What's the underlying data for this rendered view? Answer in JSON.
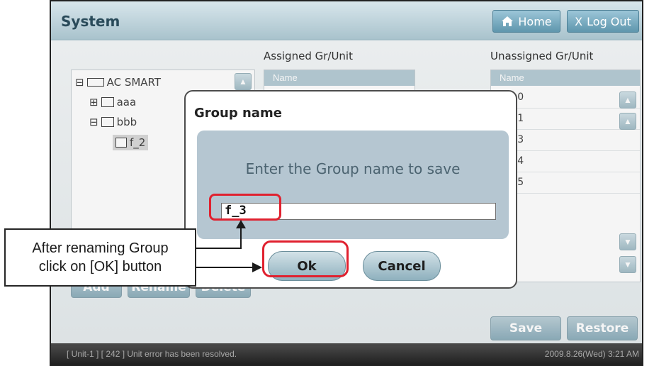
{
  "window": {
    "title": "System"
  },
  "topbar": {
    "home_label": "Home",
    "logout_label": "Log Out",
    "logout_glyph": "X"
  },
  "tree": {
    "items": [
      {
        "label": "AC SMART",
        "expander": "⊟"
      },
      {
        "label": "aaa",
        "expander": "⊞"
      },
      {
        "label": "bbb",
        "expander": "⊟"
      },
      {
        "label": "f_2",
        "expander": ""
      }
    ]
  },
  "assigned": {
    "title": "Assigned Gr/Unit",
    "header": "Name"
  },
  "unassigned": {
    "title": "Unassigned Gr/Unit",
    "header": "Name",
    "items": [
      "nit-0",
      "nit-1",
      "nit-3",
      "nit-4",
      "nit-5"
    ]
  },
  "tree_buttons": {
    "add": "Add",
    "rename": "Rename",
    "delete": "Delete"
  },
  "actions": {
    "save": "Save",
    "restore": "Restore"
  },
  "status": {
    "message": "[ Unit-1 ] [ 242 ] Unit error has been resolved.",
    "datetime": "2009.8.26(Wed) 3:21 AM"
  },
  "dialog": {
    "title": "Group name",
    "prompt": "Enter the Group name to save",
    "input_value": "f_3",
    "ok_label": "Ok",
    "cancel_label": "Cancel"
  },
  "callout": {
    "line1": "After renaming Group",
    "line2": "click on [OK] button"
  },
  "colors": {
    "accent": "#5f96ad",
    "highlight": "#e0212f",
    "status_bg": "#202020"
  },
  "icons": [
    "home-icon",
    "close-icon",
    "chevron-up-icon",
    "chevron-down-icon",
    "folder-icon",
    "group-icon"
  ]
}
